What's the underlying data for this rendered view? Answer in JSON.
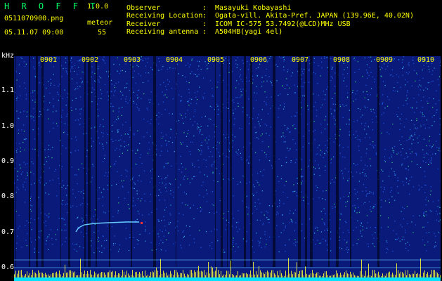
{
  "header": {
    "app_title": "H R O F F T",
    "version": "1.0.0",
    "filename": "0511070900.png",
    "datetime": "05.11.07 09:00",
    "detect_label": "meteor",
    "detect_count": "55"
  },
  "station_info": [
    {
      "label": "Observer",
      "value": "Masayuki Kobayashi"
    },
    {
      "label": "Receiving Location",
      "value": "Ogata-vill. Akita-Pref. JAPAN (139.96E, 40.02N)"
    },
    {
      "label": "Receiver",
      "value": "ICOM IC-575 53.7492(@LCD)MHz USB"
    },
    {
      "label": "Receiving antenna",
      "value": "A504HB(yagi 4el)"
    }
  ],
  "info_separator": ":",
  "spectrogram": {
    "unit_label": "kHz",
    "y_ticks": [
      "1.1",
      "1.0",
      "0.9",
      "0.8",
      "0.7",
      "0.6"
    ],
    "y_tick_values": [
      1.1,
      1.0,
      0.9,
      0.8,
      0.7,
      0.6
    ],
    "x_ticks": [
      "0901",
      "0902",
      "0903",
      "0904",
      "0905",
      "0906",
      "0907",
      "0908",
      "0909",
      "0910"
    ],
    "x_tick_minutes": [
      1,
      2,
      3,
      4,
      5,
      6,
      7,
      8,
      9,
      10
    ],
    "colors": {
      "background": "#0a1a7a",
      "noise_light": "#2a6cff",
      "noise_cyan": "#39d7ff",
      "noise_green": "#3dff7a",
      "gap": "#02082a",
      "axis_text": "#ffff00",
      "trace": "#66ccff",
      "marker": "#ff3333",
      "baseline": "#66ccff",
      "level_bars": "#ffff33",
      "level_floor": "#00e0ff"
    }
  }
}
